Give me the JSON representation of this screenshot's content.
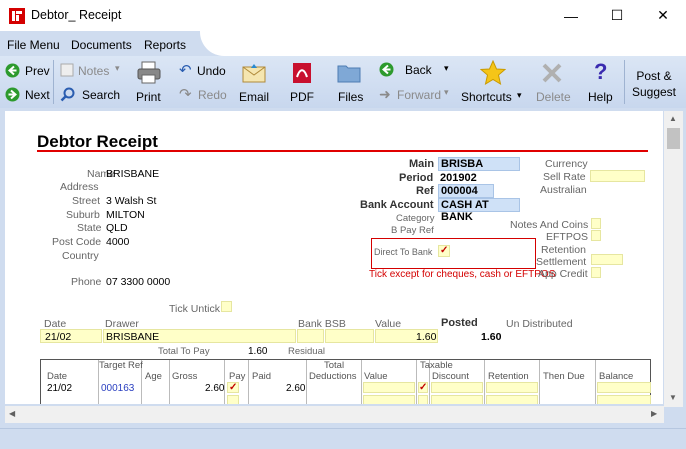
{
  "window": {
    "title": "Debtor_ Receipt",
    "minimize": "—",
    "maximize": "☐",
    "close": "✕"
  },
  "menu": {
    "items": [
      "File Menu",
      "Documents",
      "Reports"
    ]
  },
  "toolbar": {
    "prev": "Prev",
    "next": "Next",
    "notes": "Notes",
    "search": "Search",
    "print": "Print",
    "undo": "Undo",
    "redo": "Redo",
    "email": "Email",
    "pdf": "PDF",
    "files": "Files",
    "back": "Back",
    "forward": "Forward",
    "shortcuts": "Shortcuts",
    "delete": "Delete",
    "help": "Help",
    "post_suggest_1": "Post &",
    "post_suggest_2": "Suggest"
  },
  "form": {
    "heading": "Debtor Receipt",
    "left_labels": {
      "name": "Name",
      "address": "Address",
      "street": "Street",
      "suburb": "Suburb",
      "state": "State",
      "post_code": "Post Code",
      "country": "Country",
      "phone": "Phone"
    },
    "left_values": {
      "name": "BRISBANE",
      "street": "3 Walsh St",
      "suburb": "MILTON",
      "state": "QLD",
      "post_code": "4000",
      "phone": "07 3300 0000"
    },
    "mid_labels": {
      "main": "Main",
      "period": "Period",
      "ref": "Ref",
      "bank_account": "Bank Account",
      "category": "Category",
      "bpay_ref": "B Pay Ref"
    },
    "mid_values": {
      "main": "BRISBA",
      "period": "201902",
      "ref": "000004",
      "bank_account": "CASH AT BANK"
    },
    "right_labels": {
      "currency": "Currency",
      "sell_rate": "Sell Rate",
      "australian": "Australian",
      "notes_and_coins": "Notes And Coins",
      "eftpos": "EFTPOS",
      "retention": "Retention",
      "settlement": "Settlement",
      "app_credit": "App Credit"
    },
    "direct_to_bank": "Direct To Bank",
    "direct_to_bank_check": "✓",
    "tick_note": "Tick except for cheques, cash or EFTPOS",
    "tick_untick": "Tick Untick",
    "drawer_headers": {
      "date": "Date",
      "drawer": "Drawer",
      "bank_bsb": "Bank BSB",
      "value": "Value",
      "posted": "Posted",
      "un_distributed": "Un Distributed"
    },
    "drawer_row": {
      "date": "21/02",
      "drawer": "BRISBANE",
      "value": "1.60",
      "posted": "1.60"
    },
    "total_to_pay_label": "Total To Pay",
    "total_to_pay": "1.60",
    "residual_label": "Residual"
  },
  "table": {
    "header_top": {
      "target_ref": "Target Ref",
      "total": "Total",
      "taxable": "Taxable"
    },
    "headers": {
      "date": "Date",
      "age": "Age",
      "gross": "Gross",
      "pay": "Pay",
      "paid": "Paid",
      "deductions": "Deductions",
      "value": "Value",
      "discount": "Discount",
      "retention": "Retention",
      "then_due": "Then Due",
      "balance": "Balance"
    },
    "rows": [
      {
        "date": "21/02",
        "target_ref": "000163",
        "gross": "2.60",
        "pay_check": "✓",
        "paid": "2.60",
        "taxable_check": "✓"
      }
    ]
  },
  "colors": {
    "accent_red": "#d40000",
    "field_yellow": "#ffffc8",
    "field_blue": "#cfe1f7",
    "ribbon": "#cfdcef"
  }
}
